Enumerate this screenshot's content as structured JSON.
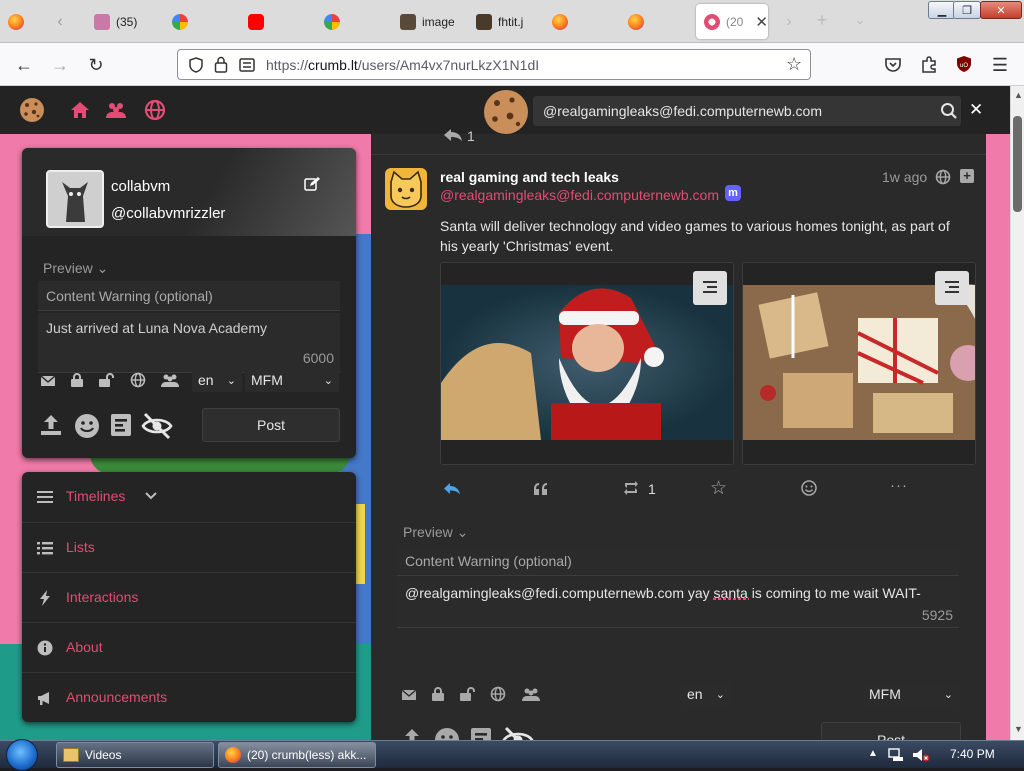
{
  "browser": {
    "tabs": [
      {
        "label": "",
        "favicon": "firefox"
      },
      {
        "label": "(35)",
        "favicon": "avatar"
      },
      {
        "label": "",
        "favicon": "google"
      },
      {
        "label": "",
        "favicon": "youtube"
      },
      {
        "label": "",
        "favicon": "google"
      },
      {
        "label": "image",
        "favicon": "image"
      },
      {
        "label": "fhtit.j",
        "favicon": "image"
      },
      {
        "label": "",
        "favicon": "firefox"
      },
      {
        "label": "",
        "favicon": "firefox"
      },
      {
        "label": "(20",
        "favicon": "crumb"
      }
    ],
    "active_tab_close": "✕",
    "new_tab": "+",
    "url_scheme": "https://",
    "url_host": "crumb.lt",
    "url_path": "/users/Am4vx7nurLkzX1N1dI"
  },
  "header": {
    "search_value": "@realgamingleaks@fedi.computernewb.com",
    "close_label": "✕"
  },
  "compose": {
    "display_name": "collabvm",
    "handle": "@collabvmrizzler",
    "preview_label": "Preview",
    "cw_placeholder": "Content Warning (optional)",
    "text": "Just arrived at Luna Nova Academy",
    "char_count": "6000",
    "language": "en",
    "format": "MFM",
    "post_label": "Post"
  },
  "nav": {
    "items": [
      {
        "label": "Timelines"
      },
      {
        "label": "Lists"
      },
      {
        "label": "Interactions"
      },
      {
        "label": "About"
      },
      {
        "label": "Announcements"
      }
    ]
  },
  "prev_post_actions": {
    "reply_count": "1"
  },
  "post": {
    "author_name": "real gaming and tech leaks",
    "author_handle": "@realgamingleaks@fedi.computernewb.com",
    "time": "1w ago",
    "body": "Santa will deliver technology and video games to various homes tonight, as part of his yearly 'Christmas' event.",
    "boost_count": "1"
  },
  "reply": {
    "preview_label": "Preview",
    "cw_placeholder": "Content Warning (optional)",
    "text": "@realgamingleaks@fedi.computernewb.com yay santa is coming to me wait WAIT-",
    "char_count": "5925",
    "language": "en",
    "format": "MFM",
    "post_label": "Post"
  },
  "taskbar": {
    "items": [
      {
        "label": "Videos"
      },
      {
        "label": "(20) crumb(less) akk..."
      }
    ],
    "clock": "7:40 PM"
  },
  "colors": {
    "accent": "#e34c74",
    "handle": "#e34c74",
    "page_bg": "#2a2a2a",
    "pink_bg": "#f07aa9"
  }
}
